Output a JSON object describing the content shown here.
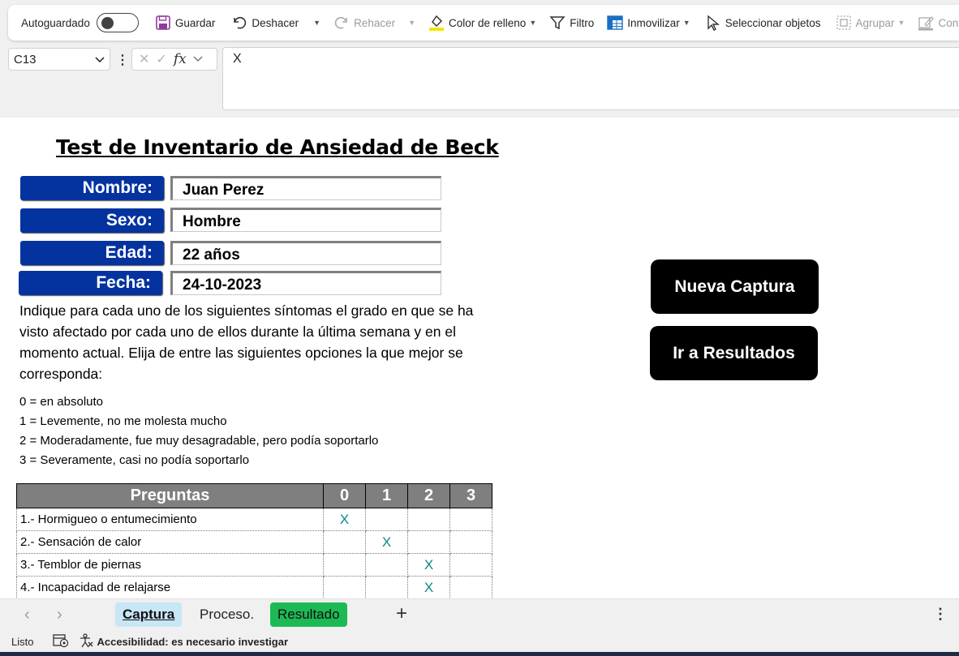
{
  "ribbon": {
    "autosave_label": "Autoguardado",
    "save_label": "Guardar",
    "undo_label": "Deshacer",
    "redo_label": "Rehacer",
    "fill_label": "Color de relleno",
    "filter_label": "Filtro",
    "freeze_label": "Inmovilizar",
    "select_label": "Seleccionar objetos",
    "group_label": "Agrupar",
    "border_label": "Contorno"
  },
  "formula_bar": {
    "name_box": "C13",
    "cancel_symbol": "✕",
    "enter_symbol": "✓",
    "fx_symbol": "fx",
    "content": "X"
  },
  "sheet": {
    "title": "Test de Inventario de Ansiedad de Beck",
    "fields": [
      {
        "label": "Nombre:",
        "value": "Juan Perez"
      },
      {
        "label": "Sexo:",
        "value": "Hombre"
      },
      {
        "label": "Edad:",
        "value": "22 años"
      },
      {
        "label": "Fecha:",
        "value": "24-10-2023"
      }
    ],
    "instructions": "Indique para cada uno de los siguientes síntomas el grado en que se ha visto afectado por cada uno de ellos durante la última semana y en el momento actual. Elija de entre las siguientes opciones la que mejor se corresponda:",
    "options": [
      "0 = en absoluto",
      "1 = Levemente, no me molesta mucho",
      "2 = Moderadamente, fue muy desagradable, pero podía soportarlo",
      "3 = Severamente, casi no podía soportarlo"
    ],
    "buttons": {
      "new_capture": "Nueva Captura",
      "go_results": "Ir a Resultados"
    },
    "table": {
      "headers": [
        "Preguntas",
        "0",
        "1",
        "2",
        "3"
      ],
      "rows": [
        {
          "question": "1.- Hormigueo o entumecimiento",
          "marks": [
            "X",
            "",
            "",
            ""
          ]
        },
        {
          "question": "2.- Sensación de calor",
          "marks": [
            "",
            "X",
            "",
            ""
          ]
        },
        {
          "question": "3.- Temblor de piernas",
          "marks": [
            "",
            "",
            "X",
            ""
          ]
        },
        {
          "question": "4.- Incapacidad de relajarse",
          "marks": [
            "",
            "",
            "X",
            ""
          ]
        }
      ]
    }
  },
  "tabs": {
    "prev": "‹",
    "next": "›",
    "items": [
      "Captura",
      "Proceso.",
      "Resultado"
    ],
    "add": "+",
    "more": "⋮"
  },
  "status": {
    "ready": "Listo",
    "accessibility": "Accesibilidad: es necesario investigar"
  }
}
